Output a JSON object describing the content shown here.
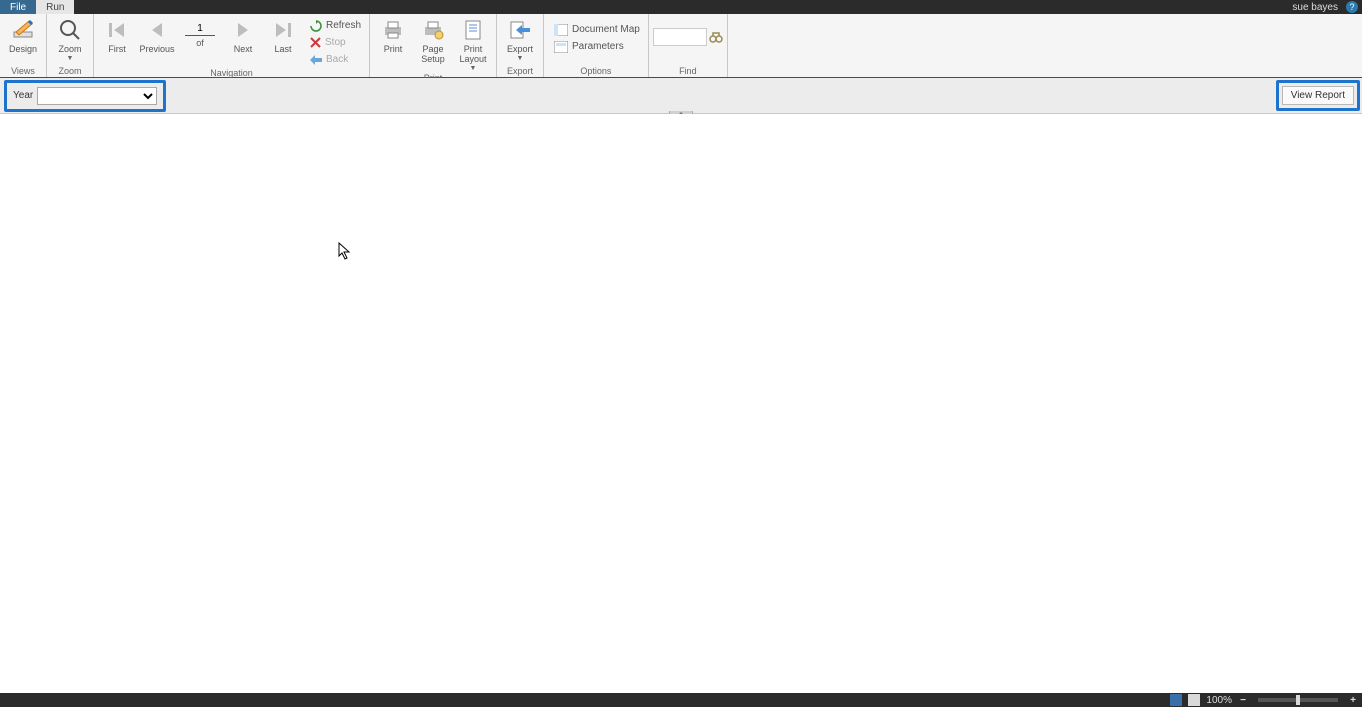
{
  "titlebar": {
    "tabs": {
      "file": "File",
      "run": "Run"
    },
    "user": "sue bayes",
    "help": "?"
  },
  "ribbon": {
    "views": {
      "design": "Design",
      "group": "Views"
    },
    "zoom": {
      "zoom": "Zoom",
      "group": "Zoom"
    },
    "nav": {
      "first": "First",
      "previous": "Previous",
      "page": "1",
      "of": "of",
      "next": "Next",
      "last": "Last",
      "refresh": "Refresh",
      "stop": "Stop",
      "back": "Back",
      "group": "Navigation"
    },
    "print": {
      "print": "Print",
      "page_setup": "Page Setup",
      "print_layout": "Print Layout",
      "group": "Print"
    },
    "export": {
      "export": "Export",
      "group": "Export"
    },
    "options": {
      "doc_map": "Document Map",
      "parameters": "Parameters",
      "group": "Options"
    },
    "find": {
      "group": "Find"
    }
  },
  "params": {
    "year_label": "Year",
    "view_report": "View Report"
  },
  "status": {
    "zoom_pct": "100%"
  }
}
